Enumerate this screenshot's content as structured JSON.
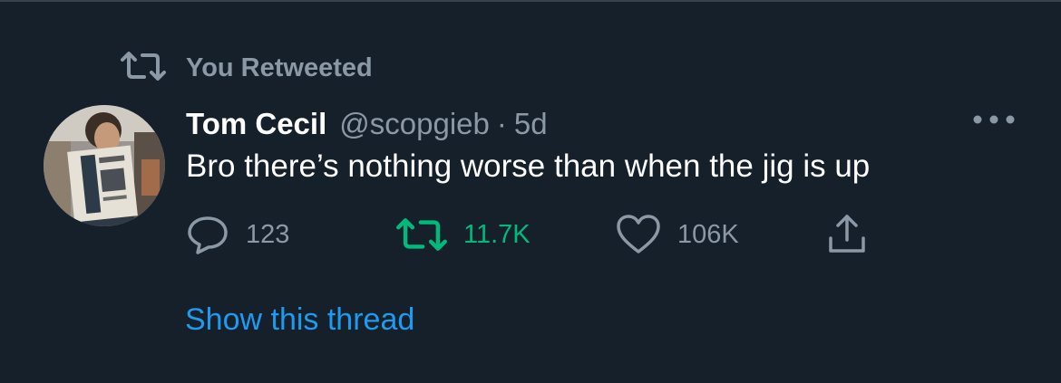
{
  "theme": {
    "background": "#15202b",
    "muted_text": "#8b98a5",
    "retweet_green": "#00ba7c",
    "link_blue": "#1d9bf0"
  },
  "context": {
    "icon": "retweet-icon",
    "label": "You Retweeted"
  },
  "tweet": {
    "avatar_icon": "avatar",
    "author_name": "Tom Cecil",
    "handle": "@scopgieb",
    "separator": "·",
    "timestamp": "5d",
    "more_icon": "more-icon",
    "text": "Bro there’s nothing worse than when the jig is up"
  },
  "actions": {
    "reply": {
      "icon": "reply-icon",
      "count": "123"
    },
    "retweet": {
      "icon": "retweet-icon",
      "count": "11.7K",
      "active": true
    },
    "like": {
      "icon": "heart-icon",
      "count": "106K"
    },
    "share": {
      "icon": "share-icon"
    }
  },
  "thread_link": "Show this thread"
}
